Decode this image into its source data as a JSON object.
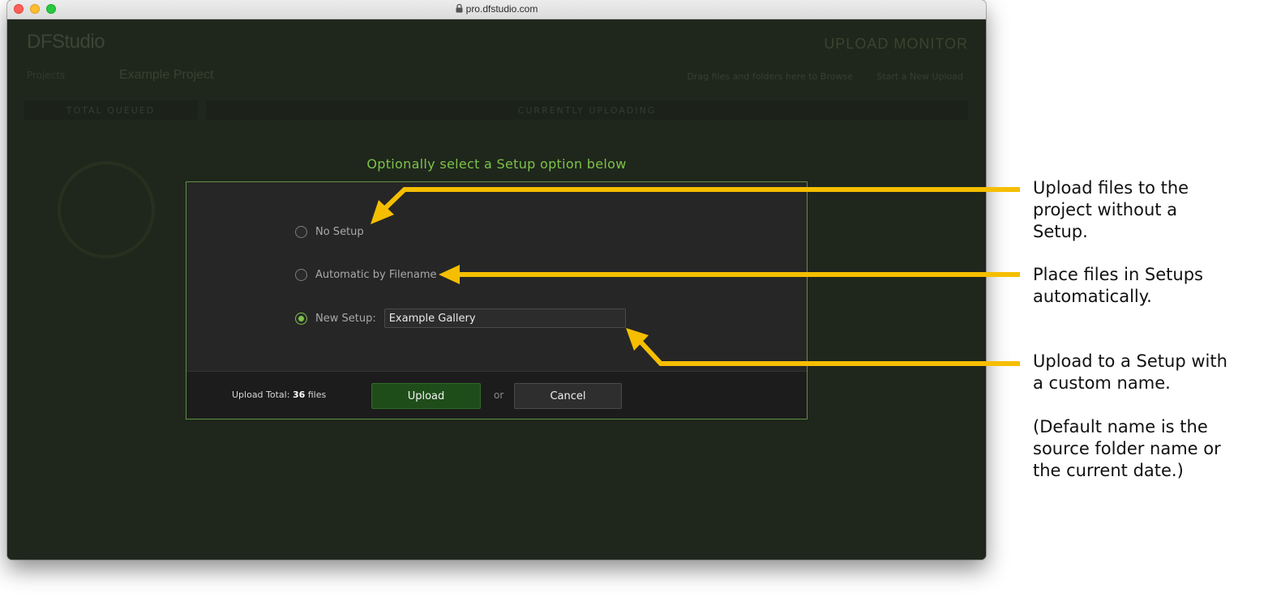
{
  "browser": {
    "url": "pro.dfstudio.com"
  },
  "app": {
    "logo": "DFStudio",
    "page_title": "UPLOAD MONITOR",
    "breadcrumb": "Projects",
    "project_name": "Example Project",
    "top_links": [
      "Drag files and folders here to Browse",
      "Start a New Upload"
    ],
    "panels": {
      "left": "TOTAL QUEUED",
      "right": "CURRENTLY UPLOADING"
    }
  },
  "modal": {
    "prompt": "Optionally select a Setup option below",
    "options": {
      "no_setup": "No Setup",
      "automatic": "Automatic by Filename",
      "new_setup": "New Setup:"
    },
    "selected": "new_setup",
    "setup_name_value": "Example Gallery",
    "footer": {
      "total_label": "Upload Total:",
      "total_count": "36",
      "total_unit": "files",
      "upload_button": "Upload",
      "or_text": "or",
      "cancel_button": "Cancel"
    }
  },
  "annotations": {
    "callout_1": "Upload files to the\nproject without a\nSetup.",
    "callout_2": "Place files in Setups\nautomatically.",
    "callout_3": "Upload to a Setup with\na custom name.",
    "callout_4": "(Default name is the\nsource folder name or\nthe current date.)",
    "arrow_color": "#f5be00"
  },
  "colors": {
    "accent_green": "#7dc24a",
    "upload_button": "#1f4d1a",
    "modal_border": "#5f8f42"
  }
}
